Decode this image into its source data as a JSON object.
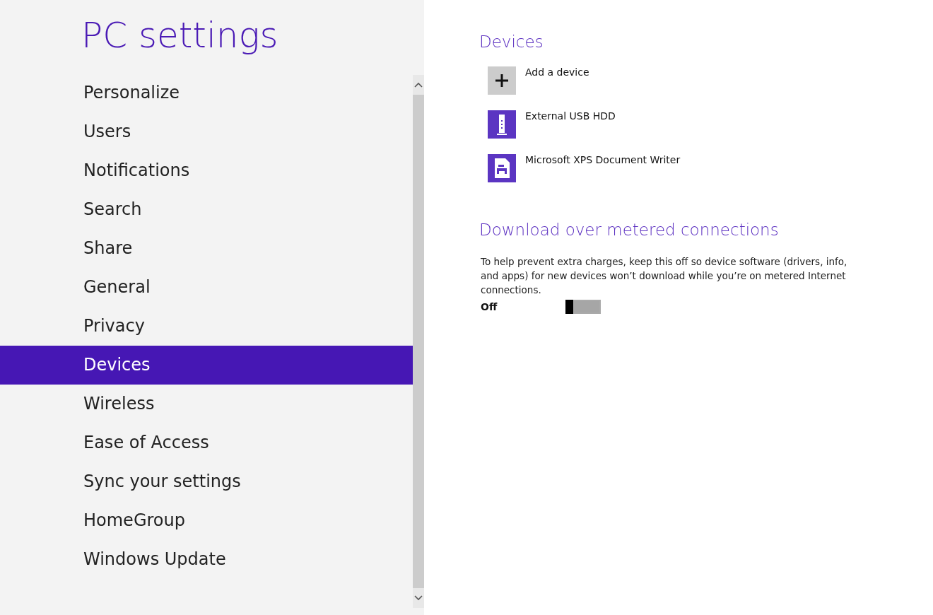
{
  "title": "PC settings",
  "nav": [
    {
      "label": "Personalize",
      "selected": false
    },
    {
      "label": "Users",
      "selected": false
    },
    {
      "label": "Notifications",
      "selected": false
    },
    {
      "label": "Search",
      "selected": false
    },
    {
      "label": "Share",
      "selected": false
    },
    {
      "label": "General",
      "selected": false
    },
    {
      "label": "Privacy",
      "selected": false
    },
    {
      "label": "Devices",
      "selected": true
    },
    {
      "label": "Wireless",
      "selected": false
    },
    {
      "label": "Ease of Access",
      "selected": false
    },
    {
      "label": "Sync your settings",
      "selected": false
    },
    {
      "label": "HomeGroup",
      "selected": false
    },
    {
      "label": "Windows Update",
      "selected": false
    }
  ],
  "devices": {
    "heading": "Devices",
    "items": [
      {
        "kind": "add",
        "label": "Add a device"
      },
      {
        "kind": "drive",
        "label": "External USB HDD"
      },
      {
        "kind": "printer",
        "label": "Microsoft XPS Document Writer"
      }
    ]
  },
  "metered": {
    "heading": "Download over metered connections",
    "description": "To help prevent extra charges, keep this off so device software (drivers, info, and apps) for new devices won’t download while you’re on metered Internet connections.",
    "state_label": "Off",
    "on": false
  }
}
